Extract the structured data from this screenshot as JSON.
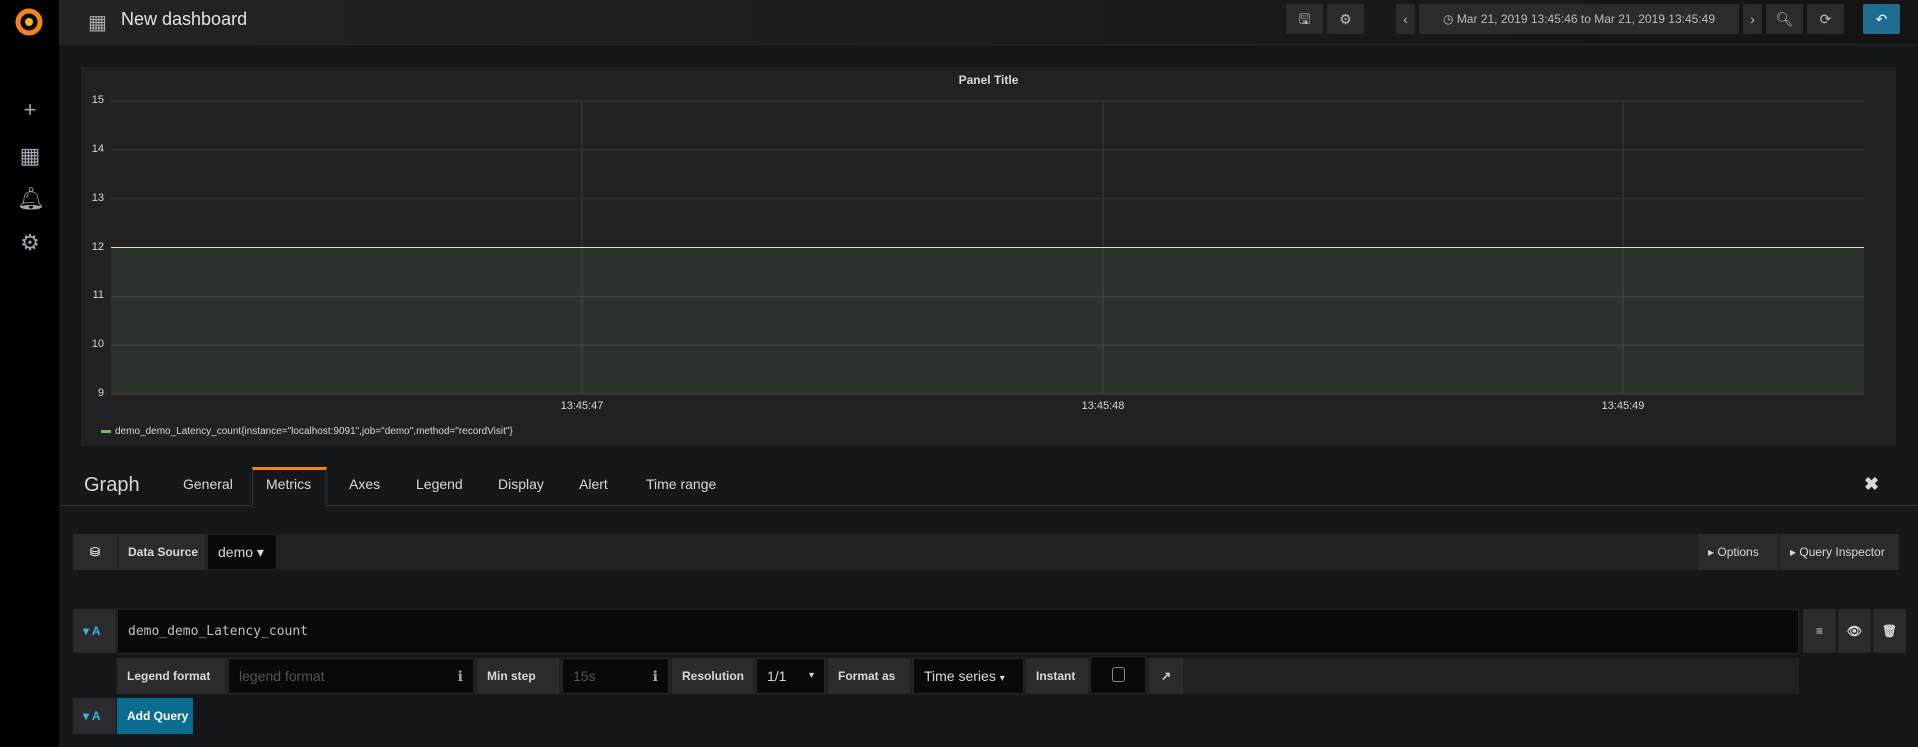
{
  "header": {
    "title": "New dashboard",
    "time_range": "Mar 21, 2019 13:45:46 to Mar 21, 2019 13:45:49"
  },
  "sidebar": {
    "items": [
      "plus-icon",
      "dashboards-icon",
      "bell-icon",
      "gear-icon"
    ]
  },
  "panel": {
    "title": "Panel Title"
  },
  "chart_data": {
    "type": "area",
    "title": "Panel Title",
    "x": [
      "13:45:46",
      "13:45:49"
    ],
    "x_ticks": [
      "13:45:47",
      "13:45:48",
      "13:45:49"
    ],
    "y_ticks": [
      "15",
      "14",
      "13",
      "12",
      "11",
      "10",
      "9"
    ],
    "ylim": [
      9,
      15
    ],
    "grid": true,
    "legend": "bottom-left",
    "series": [
      {
        "name": "demo_demo_Latency_count{instance=\"localhost:9091\",job=\"demo\",method=\"recordVisit\"}",
        "values": [
          12,
          12
        ],
        "color": "#7eb26d"
      }
    ]
  },
  "editor": {
    "title": "Graph",
    "tabs": [
      "General",
      "Metrics",
      "Axes",
      "Legend",
      "Display",
      "Alert",
      "Time range"
    ],
    "active_tab": "Metrics"
  },
  "datasource": {
    "label": "Data Source",
    "value": "demo",
    "options": "Options",
    "inspector": "Query Inspector"
  },
  "query": {
    "ref": "A",
    "expr": "demo_demo_Latency_count",
    "legend_label": "Legend format",
    "legend_placeholder": "legend format",
    "minstep_label": "Min step",
    "minstep_placeholder": "15s",
    "resolution_label": "Resolution",
    "resolution": "1/1",
    "format_label": "Format as",
    "format": "Time series",
    "instant_label": "Instant"
  },
  "add": {
    "ref": "A",
    "label": "Add Query"
  }
}
